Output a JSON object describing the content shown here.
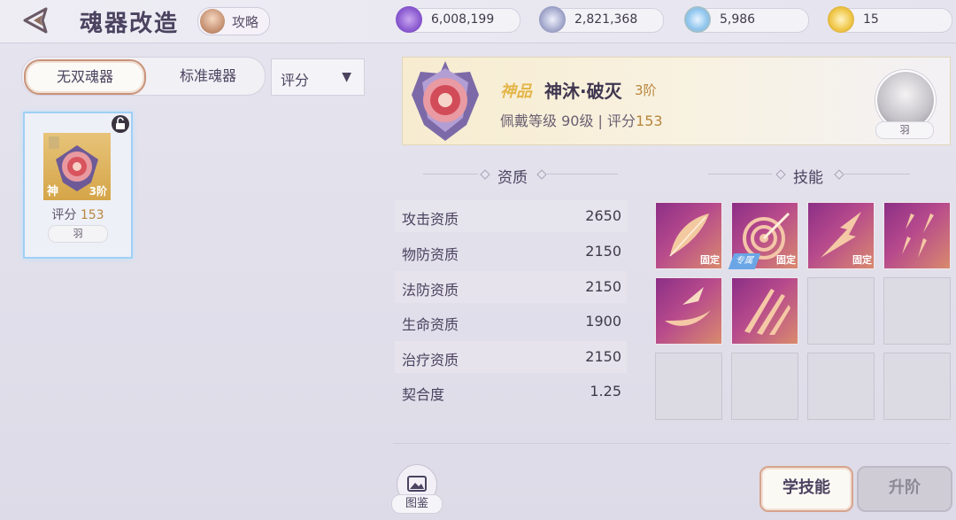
{
  "header": {
    "title": "魂器改造",
    "guide_label": "攻略",
    "currencies": [
      {
        "icon": "purple-ticket-icon",
        "value": "6,008,199"
      },
      {
        "icon": "silver-coin-icon",
        "value": "2,821,368"
      },
      {
        "icon": "blue-orb-icon",
        "value": "5,986"
      },
      {
        "icon": "gold-coin-icon",
        "value": "15"
      }
    ]
  },
  "left": {
    "tabs": [
      "无双魂器",
      "标准魂器"
    ],
    "active_tab": "无双魂器",
    "sort_label": "评分",
    "card": {
      "grade": "神",
      "tier": "3阶",
      "score_label": "评分",
      "score": "153",
      "owner": "羽"
    }
  },
  "detail": {
    "grade_tag": "神品",
    "name": "神沐·破灭",
    "tier": "3阶",
    "equip_prefix": "佩戴等级 90级 | 评分",
    "score": "153",
    "owner": "羽"
  },
  "stats": {
    "title": "资质",
    "rows": [
      {
        "name": "攻击资质",
        "value": "2650"
      },
      {
        "name": "物防资质",
        "value": "2150"
      },
      {
        "name": "法防资质",
        "value": "2150"
      },
      {
        "name": "生命资质",
        "value": "1900"
      },
      {
        "name": "治疗资质",
        "value": "2150"
      },
      {
        "name": "契合度",
        "value": "1.25"
      }
    ]
  },
  "skills": {
    "title": "技能",
    "fixed_label": "固定",
    "exclusive_label": "专属",
    "slots": [
      {
        "filled": true,
        "icon": "feather-skill-icon",
        "fixed": true,
        "exclusive": false
      },
      {
        "filled": true,
        "icon": "target-arrow-skill-icon",
        "fixed": true,
        "exclusive": true
      },
      {
        "filled": true,
        "icon": "lightning-spear-skill-icon",
        "fixed": true,
        "exclusive": false
      },
      {
        "filled": true,
        "icon": "arrow-rain-skill-icon",
        "fixed": false,
        "exclusive": false
      },
      {
        "filled": true,
        "icon": "slash-wave-skill-icon",
        "fixed": false,
        "exclusive": false
      },
      {
        "filled": true,
        "icon": "claw-strike-skill-icon",
        "fixed": false,
        "exclusive": false
      },
      {
        "filled": false
      },
      {
        "filled": false
      },
      {
        "filled": false
      },
      {
        "filled": false
      },
      {
        "filled": false
      },
      {
        "filled": false
      }
    ]
  },
  "footer": {
    "gallery_label": "图鉴",
    "learn_label": "学技能",
    "upgrade_label": "升阶"
  }
}
